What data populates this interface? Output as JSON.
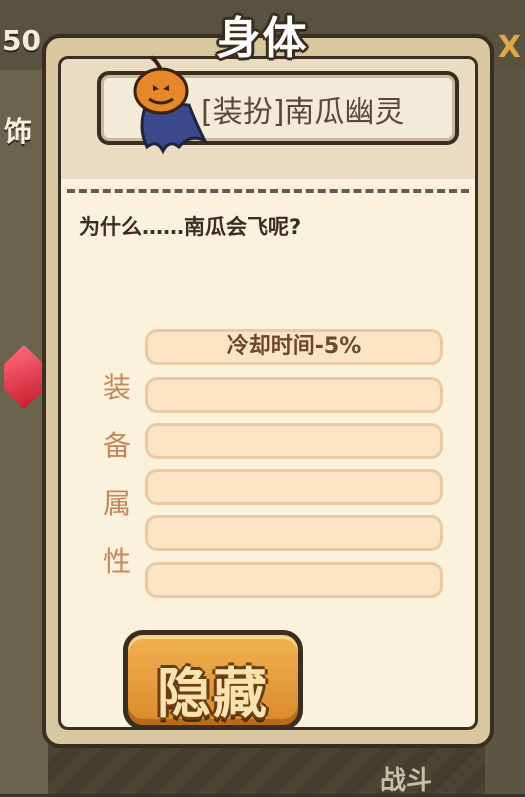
{
  "background": {
    "counter_text": "50",
    "close_glyph": "X",
    "left_tab_text": "饰",
    "bottom_text": "战斗"
  },
  "dialog": {
    "title": "身体",
    "item_name": "[装扮]南瓜幽灵",
    "item_icon": "pumpkin-ghost-icon",
    "description": "为什么……南瓜会飞呢?",
    "attributes_label": [
      "装",
      "备",
      "属",
      "性"
    ],
    "attribute_slots": [
      "冷却时间-5%",
      "",
      "",
      "",
      "",
      ""
    ],
    "hide_button_label": "隐藏"
  },
  "colors": {
    "frame_dark": "#3a2e22",
    "panel_bg": "#fbf2dd",
    "slot_fill": "#fde4c4",
    "button_orange": "#e09a38",
    "attr_label": "#c4885a"
  }
}
